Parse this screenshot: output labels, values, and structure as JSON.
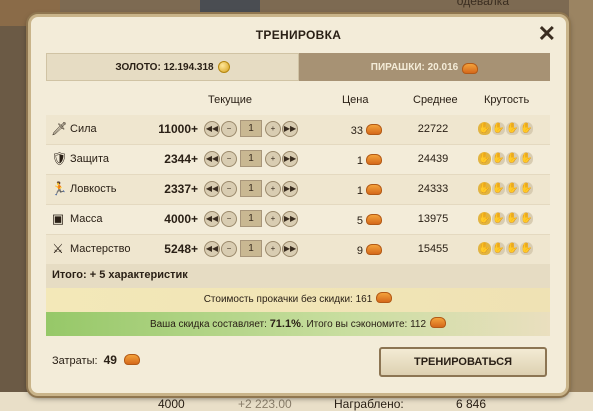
{
  "background": {
    "top_label": "одевалка",
    "bottom_values": [
      "4000",
      "+2 223.00",
      "Награблено:",
      "6 846"
    ]
  },
  "dialog": {
    "title": "ТРЕНИРОВКА",
    "close_icon": "close-x"
  },
  "currency": {
    "gold_label": "ЗОЛОТО: 12.194.318",
    "pies_label": "ПИРАШКИ: 20.016"
  },
  "table": {
    "headers": {
      "current": "Текущие",
      "price": "Цена",
      "average": "Среднее",
      "coolness": "Крутость"
    },
    "rows": [
      {
        "icon": "sword-icon",
        "name": "Сила",
        "current": "11000+",
        "value": "1",
        "price": "33",
        "average": "22722",
        "coolness": 1
      },
      {
        "icon": "shield-icon",
        "name": "Защита",
        "current": "2344+",
        "value": "1",
        "price": "1",
        "average": "24439",
        "coolness": 1
      },
      {
        "icon": "runner-icon",
        "name": "Ловкость",
        "current": "2337+",
        "value": "1",
        "price": "1",
        "average": "24333",
        "coolness": 1
      },
      {
        "icon": "weight-icon",
        "name": "Масса",
        "current": "4000+",
        "value": "1",
        "price": "5",
        "average": "13975",
        "coolness": 1
      },
      {
        "icon": "crossed-swords-icon",
        "name": "Мастерство",
        "current": "5248+",
        "value": "1",
        "price": "9",
        "average": "15455",
        "coolness": 1
      }
    ]
  },
  "summary": {
    "total": "Итого: + 5 характеристик",
    "cost_text": "Стоимость прокачки без скидки: 161",
    "discount_prefix": "Ваша скидка составляет:",
    "discount_value": "71.1%",
    "discount_suffix": ". Итого вы сэкономите: 112"
  },
  "footer": {
    "spent_label": "Затраты:",
    "spent_value": "49",
    "train_button": "ТРЕНИРОВАТЬСЯ"
  },
  "colors": {
    "accent_gold": "#e2b440",
    "discount_green": "#96c868"
  }
}
